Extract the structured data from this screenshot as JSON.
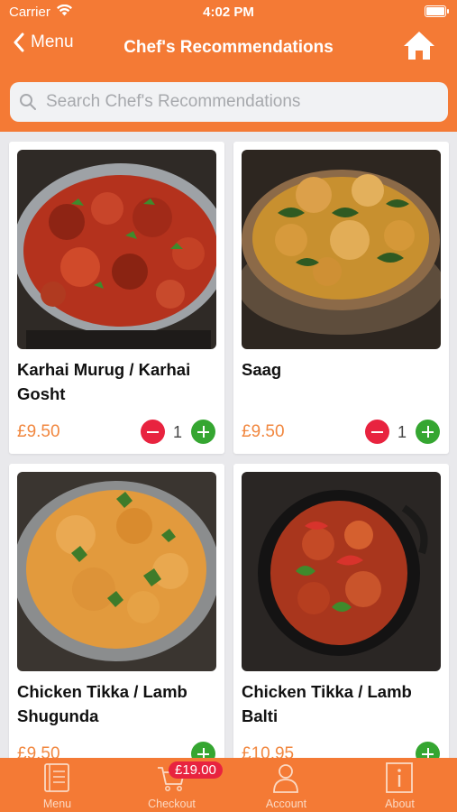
{
  "status_bar": {
    "carrier": "Carrier",
    "time": "4:02 PM"
  },
  "nav": {
    "back_label": "Menu",
    "title": "Chef's Recommendations"
  },
  "search": {
    "placeholder": "Search Chef's Recommendations"
  },
  "colors": {
    "brand": "#f47a35",
    "price": "#f1873f",
    "minus": "#e8233f",
    "plus": "#35a631",
    "badge": "#e8233f"
  },
  "items": [
    {
      "name": "Karhai Murug / Karhai Gosht",
      "price": "£9.50",
      "qty": "1",
      "image": "karhai-curry-in-steel-bowl"
    },
    {
      "name": "Saag",
      "price": "£9.50",
      "qty": "1",
      "image": "saag-curry-in-bowl"
    },
    {
      "name": "Chicken Tikka / Lamb Shugunda",
      "price": "£9.50",
      "image": "shugunda-curry-in-balti-dish"
    },
    {
      "name": "Chicken Tikka / Lamb Balti",
      "price": "£10.95",
      "image": "balti-curry-in-black-dish"
    }
  ],
  "tabs": [
    {
      "label": "Menu",
      "icon": "menu-book-icon"
    },
    {
      "label": "Checkout",
      "icon": "cart-icon"
    },
    {
      "label": "Account",
      "icon": "account-icon"
    },
    {
      "label": "About",
      "icon": "info-icon"
    }
  ],
  "cart_badge": "£19.00"
}
